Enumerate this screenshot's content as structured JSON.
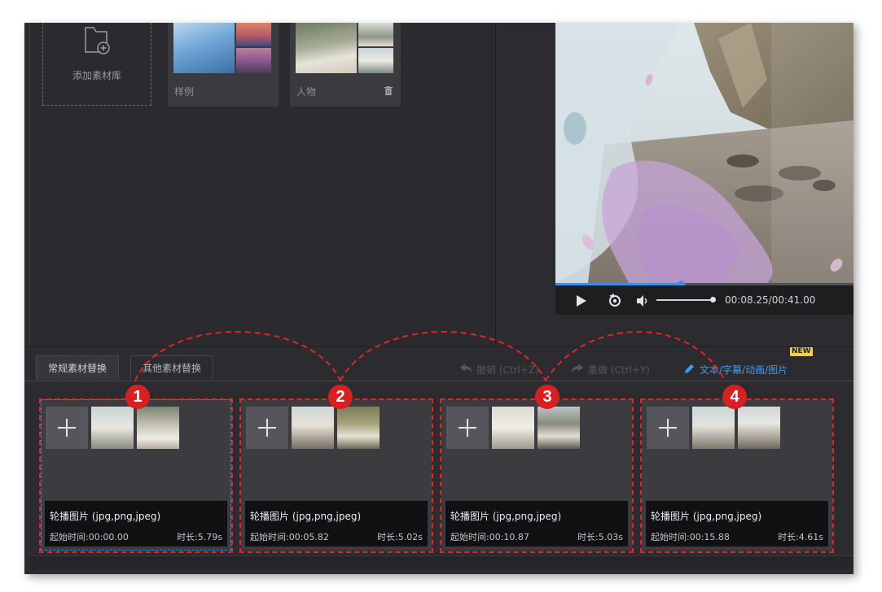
{
  "library": {
    "add_label": "添加素材库",
    "cards": [
      {
        "label": "样例"
      },
      {
        "label": "人物"
      }
    ]
  },
  "player": {
    "time": "00:08.25/00:41.00",
    "progress": 0.42,
    "volume": 0.9
  },
  "tabs": [
    {
      "label": "常规素材替换"
    },
    {
      "label": "其他素材替换"
    }
  ],
  "toolbar": {
    "undo_label": "撤销 (Ctrl+Z)",
    "redo_label": "重做 (Ctrl+Y)",
    "text_link": "文本/字幕/动画/图片",
    "new_badge": "NEW"
  },
  "slots": [
    {
      "number": "1",
      "name": "轮播图片 (jpg,png,jpeg)",
      "start": "起始时间:00:00.00",
      "duration": "时长:5.79s"
    },
    {
      "number": "2",
      "name": "轮播图片 (jpg,png,jpeg)",
      "start": "起始时间:00:05.82",
      "duration": "时长:5.02s"
    },
    {
      "number": "3",
      "name": "轮播图片 (jpg,png,jpeg)",
      "start": "起始时间:00:10.87",
      "duration": "时长:5.03s"
    },
    {
      "number": "4",
      "name": "轮播图片 (jpg,png,jpeg)",
      "start": "起始时间:00:15.88",
      "duration": "时长:4.61s"
    }
  ],
  "colors": {
    "accent": "#3a8ee6",
    "annotation": "#e12626",
    "badge": "#d72020"
  }
}
